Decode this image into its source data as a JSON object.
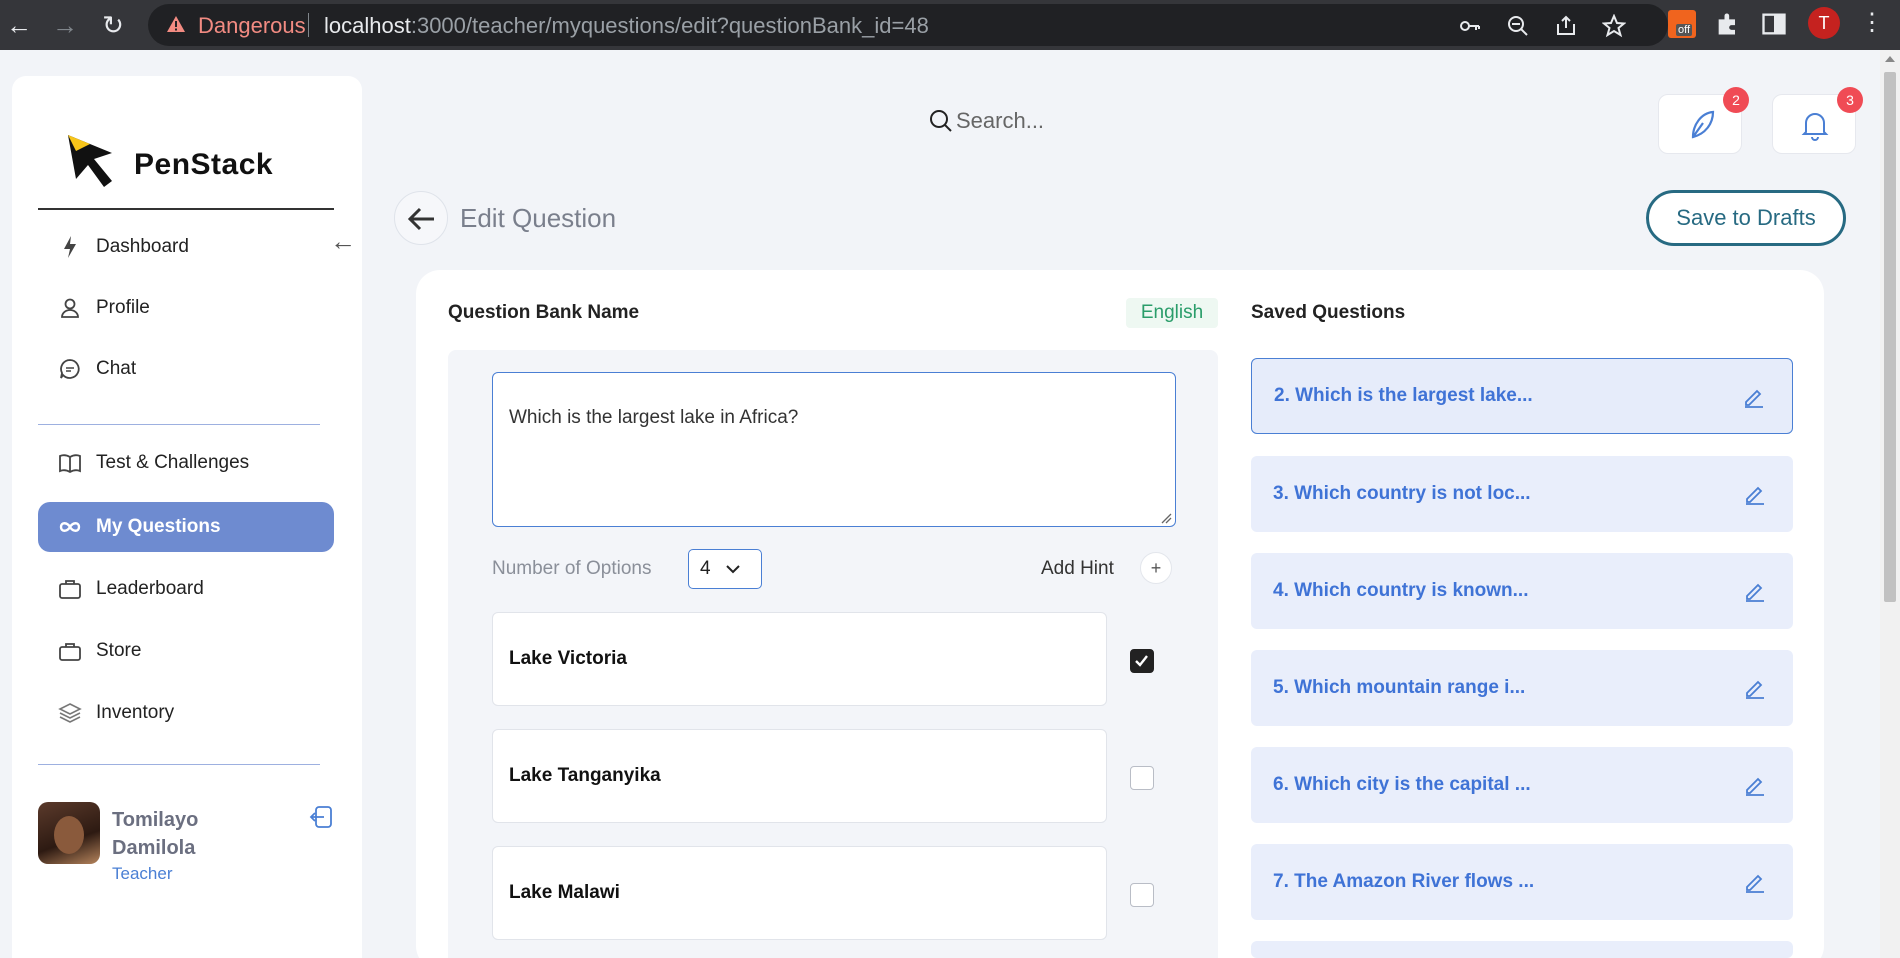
{
  "browser": {
    "warning_label": "Dangerous",
    "url_host": "localhost",
    "url_path": ":3000/teacher/myquestions/edit?questionBank_id=48",
    "profile_initial": "T",
    "ext_off_label": "off"
  },
  "sidebar": {
    "brand": "PenStack",
    "nav_top": [
      {
        "label": "Dashboard",
        "icon": "lightning-icon"
      },
      {
        "label": "Profile",
        "icon": "user-icon"
      },
      {
        "label": "Chat",
        "icon": "chat-icon"
      }
    ],
    "nav_bottom": [
      {
        "label": "Test & Challenges",
        "icon": "book-icon"
      },
      {
        "label": "My Questions",
        "icon": "infinity-icon",
        "active": true
      },
      {
        "label": "Leaderboard",
        "icon": "briefcase-icon"
      },
      {
        "label": "Store",
        "icon": "bag-icon"
      },
      {
        "label": "Inventory",
        "icon": "layers-icon"
      }
    ],
    "user": {
      "name": "Tomilayo Damilola",
      "role": "Teacher"
    }
  },
  "topbar": {
    "search_placeholder": "Search...",
    "feather_badge": "2",
    "bell_badge": "3"
  },
  "header": {
    "title": "Edit Question",
    "save_label": "Save to Drafts"
  },
  "editor": {
    "bank_name_label": "Question Bank Name",
    "language": "English",
    "question_text": "Which is the largest lake in Africa?",
    "num_options_label": "Number of Options",
    "num_options_value": "4",
    "add_hint_label": "Add Hint",
    "options": [
      {
        "text": "Lake Victoria",
        "correct": true
      },
      {
        "text": "Lake Tanganyika",
        "correct": false
      },
      {
        "text": "Lake Malawi",
        "correct": false
      }
    ]
  },
  "saved": {
    "label": "Saved Questions",
    "items": [
      "2. Which is the largest lake...",
      "3. Which country is not loc...",
      "4. Which country is known...",
      "5. Which mountain range i...",
      "6. Which city is the capital ...",
      "7. The Amazon River flows ..."
    ]
  },
  "colors": {
    "accent": "#6e8bd0",
    "link": "#3f73d6",
    "save_border": "#276a82",
    "badge": "#f04b55"
  }
}
